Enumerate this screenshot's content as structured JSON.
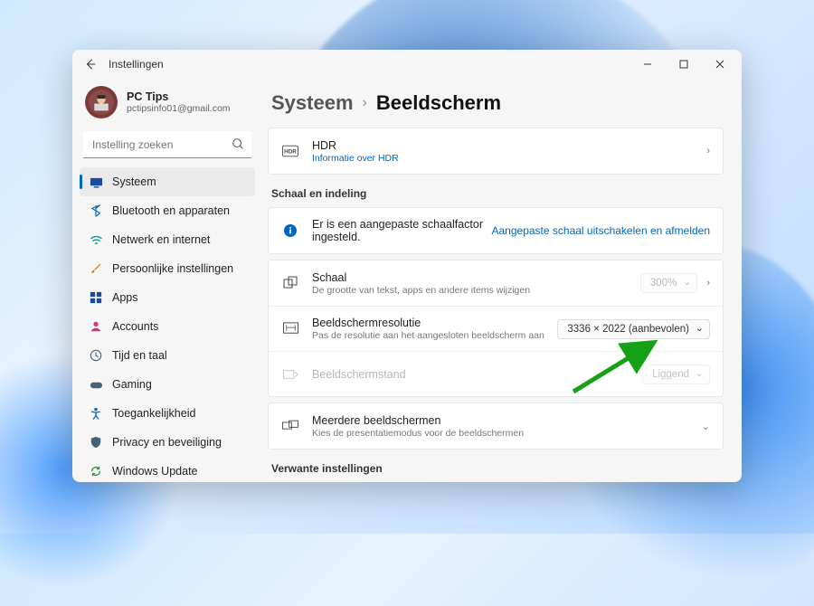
{
  "window": {
    "title": "Instellingen"
  },
  "profile": {
    "name": "PC Tips",
    "email": "pctipsinfo01@gmail.com"
  },
  "search": {
    "placeholder": "Instelling zoeken"
  },
  "sidebar": {
    "items": [
      {
        "label": "Systeem"
      },
      {
        "label": "Bluetooth en apparaten"
      },
      {
        "label": "Netwerk en internet"
      },
      {
        "label": "Persoonlijke instellingen"
      },
      {
        "label": "Apps"
      },
      {
        "label": "Accounts"
      },
      {
        "label": "Tijd en taal"
      },
      {
        "label": "Gaming"
      },
      {
        "label": "Toegankelijkheid"
      },
      {
        "label": "Privacy en beveiliging"
      },
      {
        "label": "Windows Update"
      }
    ]
  },
  "breadcrumb": {
    "parent": "Systeem",
    "current": "Beeldscherm"
  },
  "hdr": {
    "title": "HDR",
    "sub": "Informatie over HDR"
  },
  "section1": {
    "heading": "Schaal en indeling"
  },
  "alert": {
    "text": "Er is een aangepaste schaalfactor ingesteld.",
    "link": "Aangepaste schaal uitschakelen en afmelden"
  },
  "scale": {
    "title": "Schaal",
    "sub": "De grootte van tekst, apps en andere items wijzigen",
    "value": "300%"
  },
  "resolution": {
    "title": "Beeldschermresolutie",
    "sub": "Pas de resolutie aan het aangesloten beeldscherm aan",
    "value": "3336 × 2022 (aanbevolen)"
  },
  "orientation": {
    "title": "Beeldschermstand",
    "value": "Liggend"
  },
  "multi": {
    "title": "Meerdere beeldschermen",
    "sub": "Kies de presentatiemodus voor de beeldschermen"
  },
  "section2": {
    "heading": "Verwante instellingen"
  }
}
